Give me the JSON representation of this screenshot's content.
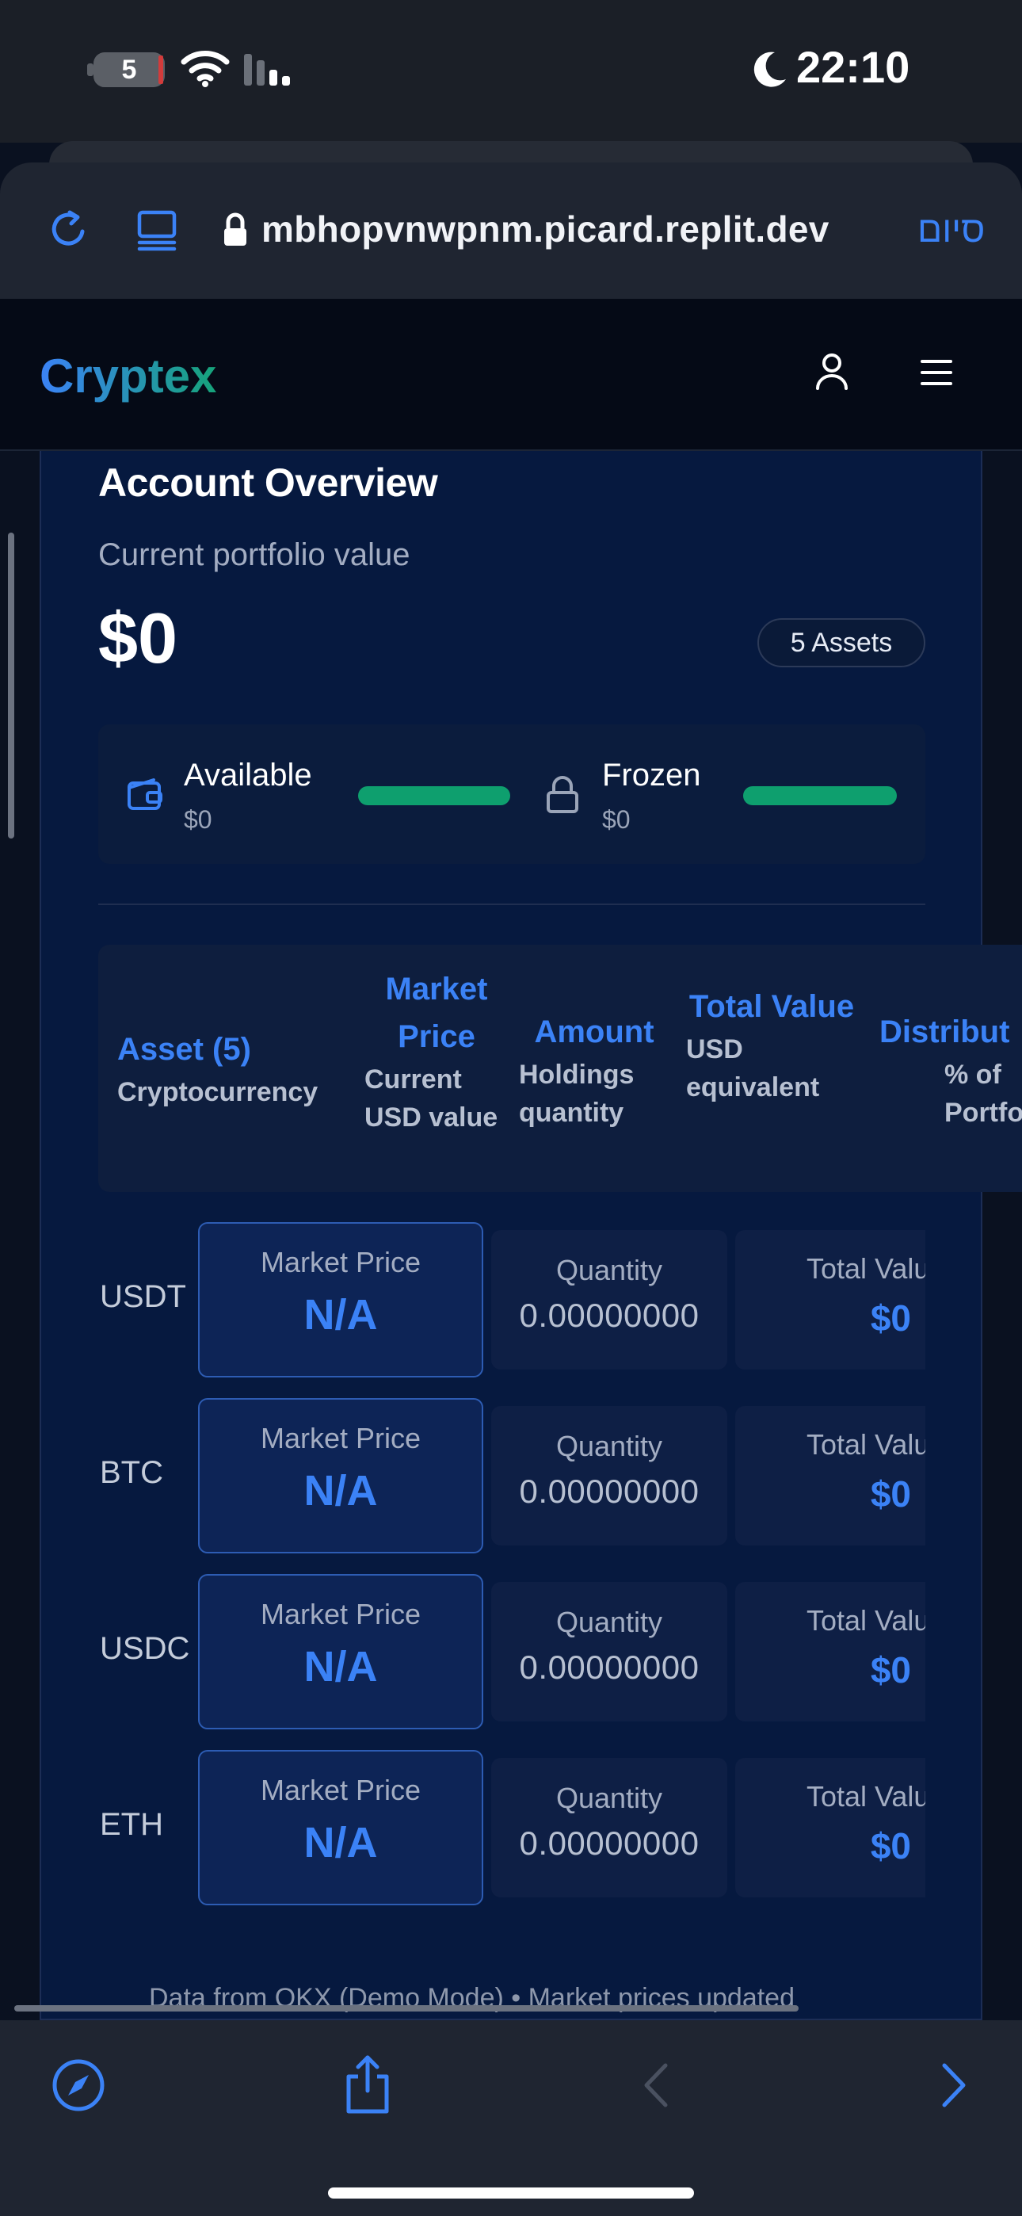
{
  "status_bar": {
    "battery_level": "5",
    "time": "22:10",
    "icons": [
      "battery-icon",
      "wifi-icon",
      "signal-icon",
      "moon-icon"
    ]
  },
  "browser": {
    "url": "mbhopvnwpnm.picard.replit.dev",
    "done_label": "סיום",
    "icons": [
      "reload-icon",
      "reader-icon",
      "lock-icon"
    ],
    "accent": "#3b82f6"
  },
  "app": {
    "logo": "Cryptex",
    "logo_gradient": [
      "#3b82f6",
      "#16a37a"
    ]
  },
  "overview": {
    "title": "Account Overview",
    "subtitle": "Current portfolio value",
    "value": "$0",
    "assets_badge": "5 Assets",
    "available": {
      "label": "Available",
      "value": "$0",
      "bar_fill": 1.0
    },
    "frozen": {
      "label": "Frozen",
      "value": "$0",
      "bar_fill": 1.0
    },
    "bar_color": "#0e9f6e"
  },
  "table": {
    "headers": [
      {
        "title": "Asset (5)",
        "sub": "Cryptocurrency"
      },
      {
        "title": "Market Price",
        "sub": "Current USD value"
      },
      {
        "title": "Amount",
        "sub": "Holdings quantity"
      },
      {
        "title": "Total Value",
        "sub": "USD equivalent"
      },
      {
        "title": "Distribut",
        "sub": "% of Portfoli"
      }
    ],
    "rows": [
      {
        "symbol": "USDT",
        "price_label": "Market Price",
        "price": "N/A",
        "qty_label": "Quantity",
        "qty": "0.00000000",
        "total_label": "Total Valu",
        "total": "$0"
      },
      {
        "symbol": "BTC",
        "price_label": "Market Price",
        "price": "N/A",
        "qty_label": "Quantity",
        "qty": "0.00000000",
        "total_label": "Total Valu",
        "total": "$0"
      },
      {
        "symbol": "USDC",
        "price_label": "Market Price",
        "price": "N/A",
        "qty_label": "Quantity",
        "qty": "0.00000000",
        "total_label": "Total Valu",
        "total": "$0"
      },
      {
        "symbol": "ETH",
        "price_label": "Market Price",
        "price": "N/A",
        "qty_label": "Quantity",
        "qty": "0.00000000",
        "total_label": "Total Valu",
        "total": "$0"
      }
    ]
  },
  "footnote": "Data from OKX (Demo Mode) • Market prices updated",
  "toolbar": {
    "icons": [
      "compass-icon",
      "share-icon",
      "back-icon",
      "forward-icon"
    ]
  }
}
